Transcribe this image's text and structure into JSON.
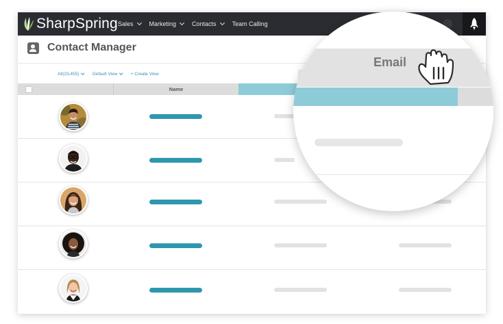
{
  "app": {
    "brand": "SharpSpring",
    "nav": [
      {
        "label": "Sales",
        "dropdown": true
      },
      {
        "label": "Marketing",
        "dropdown": true
      },
      {
        "label": "Contacts",
        "dropdown": true
      },
      {
        "label": "Team Calling",
        "dropdown": false
      }
    ],
    "rocket_icon": "rocket-icon"
  },
  "page": {
    "title": "Contact Manager",
    "filters": [
      {
        "label": "All(23,455)",
        "dropdown": true
      },
      {
        "label": "Default View",
        "dropdown": true
      },
      {
        "label": "+ Create View",
        "dropdown": false
      }
    ]
  },
  "table": {
    "columns": [
      "Name"
    ],
    "rows": [
      {
        "avatar": "man-striped-shirt"
      },
      {
        "avatar": "man-glasses"
      },
      {
        "avatar": "woman-dark-hair"
      },
      {
        "avatar": "woman-curly-hair"
      },
      {
        "avatar": "woman-blonde"
      }
    ]
  },
  "magnifier": {
    "column_label": "Email",
    "cursor_icon": "grab-hand-icon"
  },
  "colors": {
    "nav_bg": "#2b2c31",
    "accent_teal": "#2f97ad",
    "header_teal": "#8ecbd8",
    "link_blue": "#3a8fb5",
    "brand_green": "#7fc242"
  }
}
